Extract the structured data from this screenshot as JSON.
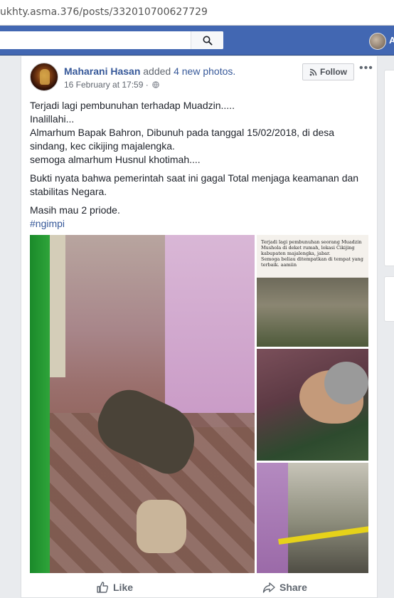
{
  "browser": {
    "url": "ukhty.asma.376/posts/332010700627729"
  },
  "topbar": {
    "search_icon": "search-icon",
    "profile_initial": "A",
    "brand_color": "#4267b2"
  },
  "post": {
    "author": "Maharani Hasan",
    "action": "added",
    "photo_count_text": "4 new photos.",
    "timestamp": "16 February at 17:59 ·",
    "audience_icon": "globe-icon",
    "follow_label": "Follow",
    "more_label": "•••",
    "paragraphs": {
      "p1": "Terjadi lagi pembunuhan terhadap Muadzin.....",
      "p2": "Inalillahi...",
      "p3": "Almarhum Bapak Bahron, Dibunuh pada tanggal 15/02/2018, di desa sindang, kec cikijing majalengka.",
      "p4": "semoga almarhum Husnul khotimah....",
      "p5": "Bukti nyata bahwa pemerintah saat ini gagal Total menjaga keamanan dan stabilitas Negara.",
      "p6": "Masih mau 2 priode.",
      "hashtag": "#ngimpi"
    },
    "photo_caption": {
      "line1": "Terjadi lagi pembunuhan seorang Muadzin",
      "line2": "Mushola di deket rumah, lokasi Cikijing",
      "line3": "kabupaten majalengka, jabar.",
      "line4": "Semoga beliau ditempatkan di tempat yang",
      "line5": "terbaik. aamiin"
    }
  },
  "actions": {
    "like_label": "Like",
    "share_label": "Share"
  }
}
